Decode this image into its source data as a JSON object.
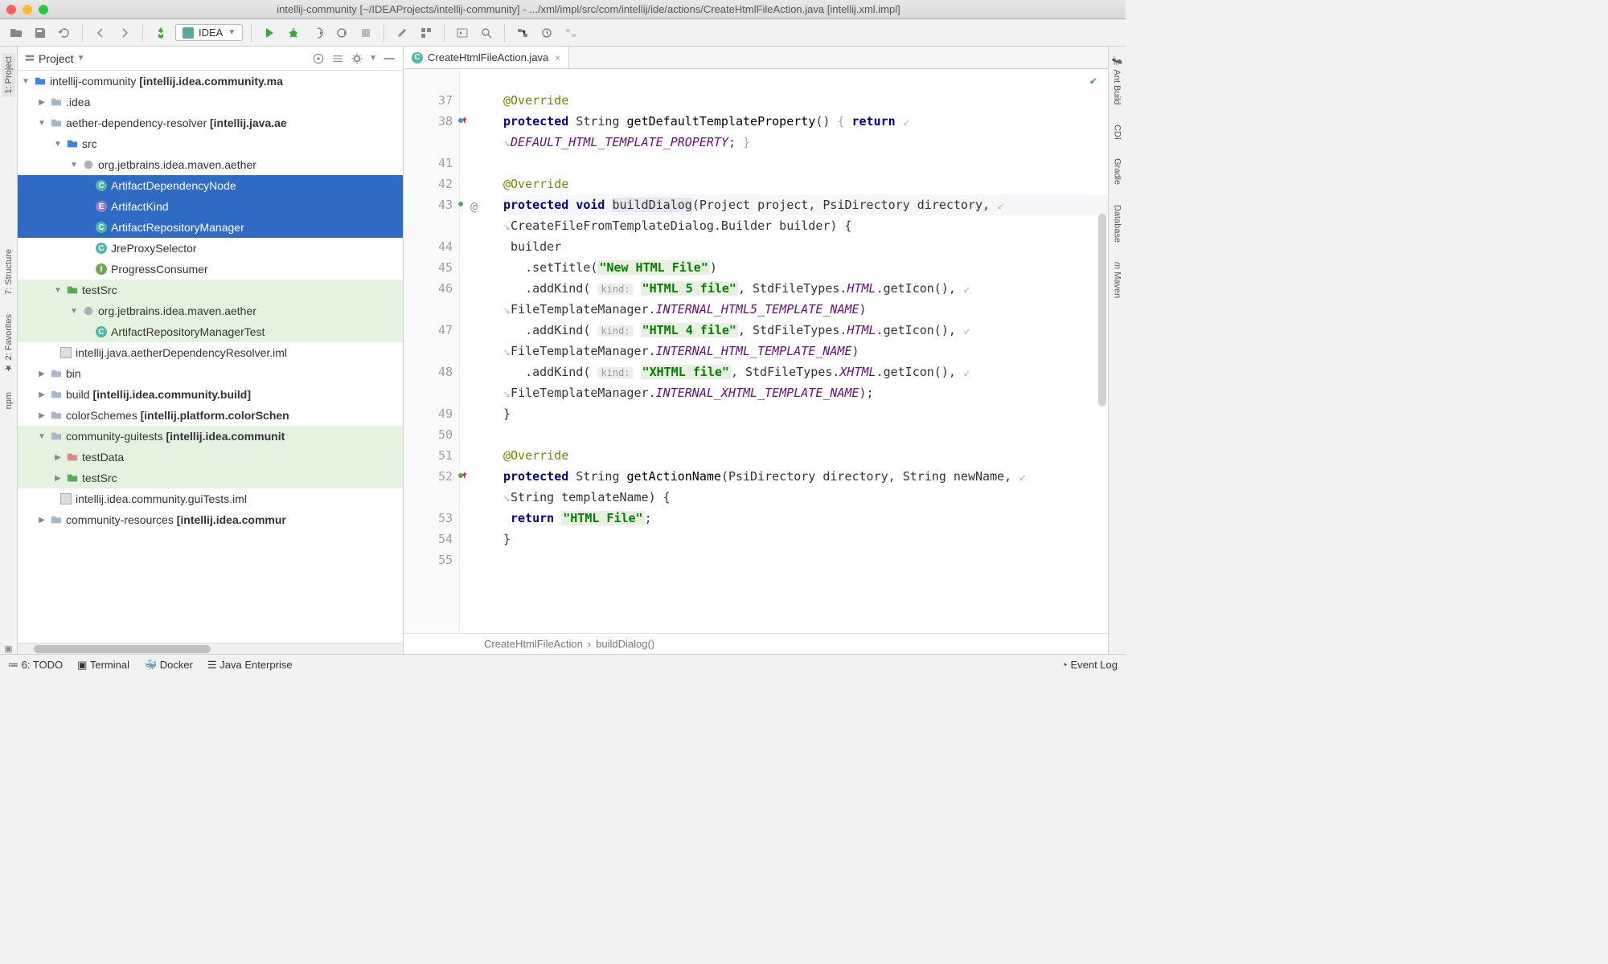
{
  "window": {
    "title": "intellij-community [~/IDEAProjects/intellij-community] - .../xml/impl/src/com/intellij/ide/actions/CreateHtmlFileAction.java [intellij.xml.impl]"
  },
  "toolbar": {
    "config": "IDEA"
  },
  "leftTabs": {
    "project": "1: Project",
    "structure": "7: Structure",
    "favorites": "2: Favorites",
    "npm": "npm"
  },
  "rightTabs": {
    "ant": "Ant Build",
    "cdi": "CDI",
    "gradle": "Gradle",
    "database": "Database",
    "maven": "Maven"
  },
  "projectPanel": {
    "title": "Project"
  },
  "tree": {
    "root": {
      "name": "intellij-community",
      "module": "[intellij.idea.community.ma"
    },
    "idea": ".idea",
    "aether": {
      "name": "aether-dependency-resolver",
      "module": "[intellij.java.ae"
    },
    "src": "src",
    "pkg": "org.jetbrains.idea.maven.aether",
    "c1": "ArtifactDependencyNode",
    "c2": "ArtifactKind",
    "c3": "ArtifactRepositoryManager",
    "c4": "JreProxySelector",
    "c5": "ProgressConsumer",
    "testSrc": "testSrc",
    "tpkg": "org.jetbrains.idea.maven.aether",
    "tc1": "ArtifactRepositoryManagerTest",
    "iml1": "intellij.java.aetherDependencyResolver.iml",
    "bin": "bin",
    "build": {
      "name": "build",
      "module": "[intellij.idea.community.build]"
    },
    "color": {
      "name": "colorSchemes",
      "module": "[intellij.platform.colorSchen"
    },
    "gui": {
      "name": "community-guitests",
      "module": "[intellij.idea.communit"
    },
    "testData": "testData",
    "testSrc2": "testSrc",
    "iml2": "intellij.idea.community.guiTests.iml",
    "res": {
      "name": "community-resources",
      "module": "[intellij.idea.commur"
    }
  },
  "tab": {
    "name": "CreateHtmlFileAction.java"
  },
  "breadcrumb": {
    "a": "CreateHtmlFileAction",
    "b": "buildDialog()"
  },
  "code": {
    "lines": [
      "",
      "37",
      "38",
      "",
      "41",
      "42",
      "43",
      "",
      "44",
      "45",
      "46",
      "",
      "47",
      "",
      "48",
      "",
      "49",
      "50",
      "51",
      "52",
      "",
      "53",
      "54",
      "55"
    ],
    "override": "@Override",
    "protected": "protected",
    "void": "void",
    "return": "return",
    "String": "String",
    "getDefaultTemplateProperty": "getDefaultTemplateProperty",
    "DEFAULT_HTML_TEMPLATE_PROPERTY": "DEFAULT_HTML_TEMPLATE_PROPERTY",
    "buildDialog": "buildDialog",
    "Project": "Project",
    "project": "project",
    "PsiDirectory": "PsiDirectory",
    "directory": "directory",
    "CreateFileFromTemplateDialog": "CreateFileFromTemplateDialog.Builder",
    "builder": "builder",
    "builderv": "builder",
    "setTitle": ".setTitle(",
    "newHtml": "\"New HTML File\"",
    "addKind": ".addKind(",
    "kind": "kind:",
    "html5": "\"HTML 5 file\"",
    "html4": "\"HTML 4 file\"",
    "xhtml": "\"XHTML file\"",
    "StdFileTypes": ", StdFileTypes.",
    "HTML": "HTML",
    "XHTML": "XHTML",
    "getIcon": ".getIcon(),",
    "FileTemplateManager": "FileTemplateManager.",
    "INTERNAL_HTML5": "INTERNAL_HTML5_TEMPLATE_NAME",
    "INTERNAL_HTML": "INTERNAL_HTML_TEMPLATE_NAME",
    "INTERNAL_XHTML": "INTERNAL_XHTML_TEMPLATE_NAME",
    "getActionName": "getActionName",
    "newName": "newName",
    "templateName": "templateName",
    "htmlFile": "\"HTML File\""
  },
  "bottom": {
    "todo": "6: TODO",
    "terminal": "Terminal",
    "docker": "Docker",
    "je": "Java Enterprise",
    "eventlog": "Event Log"
  }
}
